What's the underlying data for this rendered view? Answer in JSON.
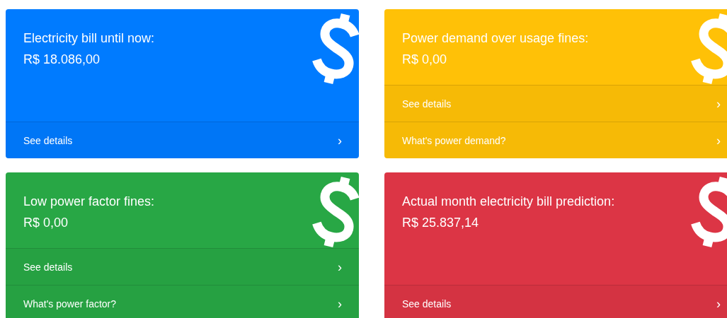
{
  "cards": [
    {
      "color": "#007bff",
      "title": "Electricity bill until now:",
      "value": "R$ 18.086,00",
      "links": [
        {
          "label": "See details",
          "arrow": "›"
        }
      ]
    },
    {
      "color": "#ffc107",
      "title": "Power demand over usage fines:",
      "value": "R$ 0,00",
      "links": [
        {
          "label": "See details",
          "arrow": "›"
        },
        {
          "label": "What's power demand?",
          "arrow": "›"
        }
      ]
    },
    {
      "color": "#28a745",
      "title": "Low power factor fines:",
      "value": "R$ 0,00",
      "links": [
        {
          "label": "See details",
          "arrow": "›"
        },
        {
          "label": "What's power factor?",
          "arrow": "›"
        }
      ]
    },
    {
      "color": "#dc3545",
      "title": "Actual month electricity bill prediction:",
      "value": "R$ 25.837,14",
      "links": [
        {
          "label": "See details",
          "arrow": "›"
        }
      ]
    }
  ]
}
